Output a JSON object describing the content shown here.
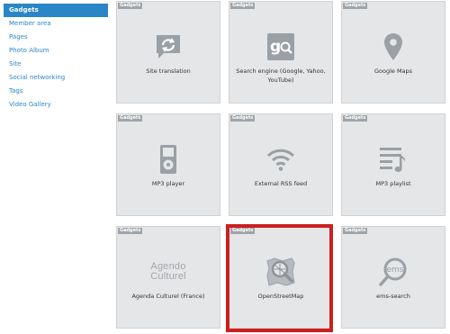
{
  "sidebar": {
    "items": [
      {
        "label": "Gadgets"
      },
      {
        "label": "Member area"
      },
      {
        "label": "Pages"
      },
      {
        "label": "Photo Album"
      },
      {
        "label": "Site"
      },
      {
        "label": "Social networking"
      },
      {
        "label": "Tags"
      },
      {
        "label": "Video Gallery"
      }
    ]
  },
  "badge_label": "Gadgets",
  "tiles": [
    {
      "label": "Site translation",
      "icon": "translate-icon"
    },
    {
      "label": "Search engine (Google, Yahoo, YouTube)",
      "icon": "google-search-icon"
    },
    {
      "label": "Google Maps",
      "icon": "map-pin-icon"
    },
    {
      "label": "MP3 player",
      "icon": "mp3-player-icon"
    },
    {
      "label": "External RSS feed",
      "icon": "wifi-feed-icon"
    },
    {
      "label": "MP3 playlist",
      "icon": "playlist-icon"
    },
    {
      "label": "Agenda Culturel (France)",
      "icon": "agenda-culturel-logo",
      "logo_line1": "Agendo",
      "logo_line2": "Culturel"
    },
    {
      "label": "OpenStreetMap",
      "icon": "openstreetmap-icon"
    },
    {
      "label": "ems-search",
      "icon": "ems-icon",
      "logo_text": "ems"
    }
  ]
}
